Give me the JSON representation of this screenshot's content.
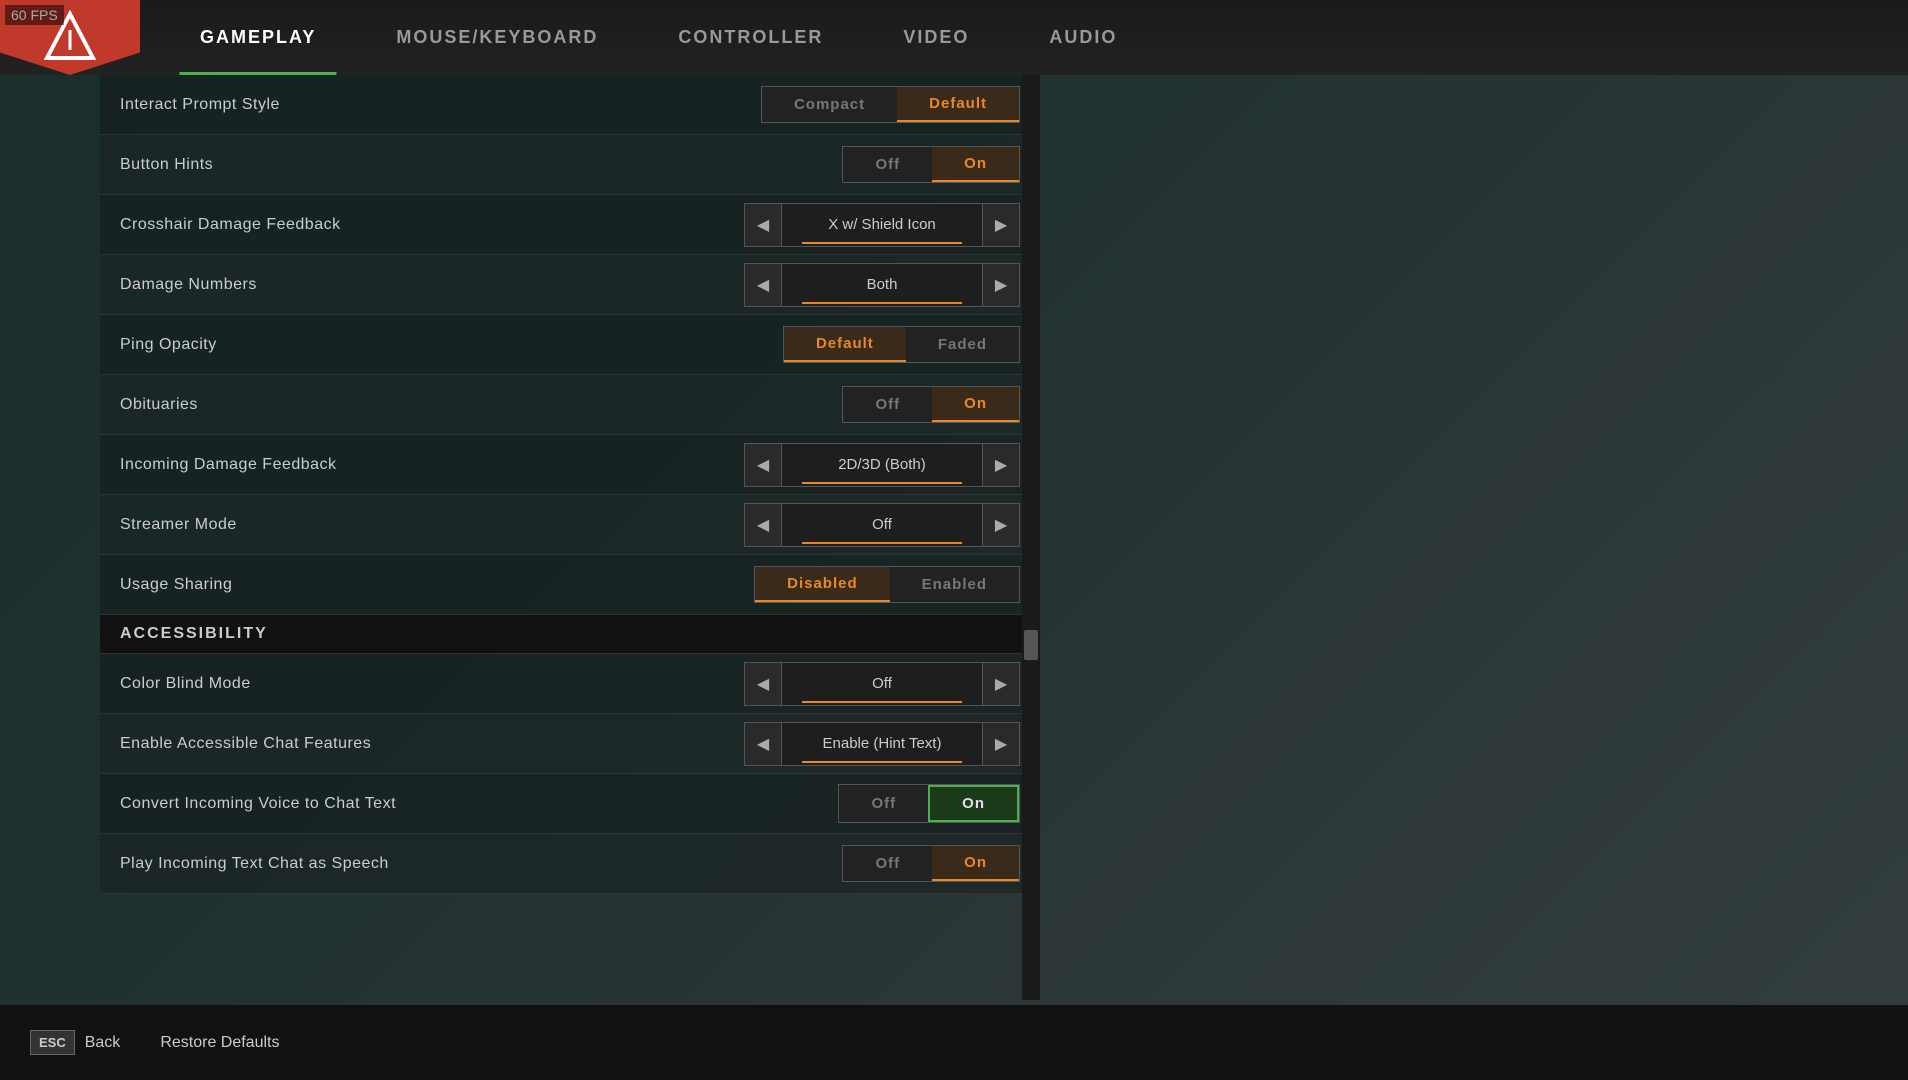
{
  "fps": "60 FPS",
  "nav": {
    "tabs": [
      {
        "id": "gameplay",
        "label": "GAMEPLAY",
        "active": true
      },
      {
        "id": "mouse_keyboard",
        "label": "MOUSE/KEYBOARD",
        "active": false
      },
      {
        "id": "controller",
        "label": "CONTROLLER",
        "active": false
      },
      {
        "id": "video",
        "label": "VIDEO",
        "active": false
      },
      {
        "id": "audio",
        "label": "AUDIO",
        "active": false
      }
    ]
  },
  "settings": [
    {
      "id": "interact_prompt_style",
      "label": "Interact Prompt Style",
      "type": "dual_button",
      "options": [
        "Compact",
        "Default"
      ],
      "selected": "Default"
    },
    {
      "id": "button_hints",
      "label": "Button Hints",
      "type": "dual_button",
      "options": [
        "Off",
        "On"
      ],
      "selected": "On"
    },
    {
      "id": "crosshair_damage_feedback",
      "label": "Crosshair Damage Feedback",
      "type": "arrow_selector",
      "value": "X w/ Shield Icon"
    },
    {
      "id": "damage_numbers",
      "label": "Damage Numbers",
      "type": "arrow_selector",
      "value": "Both"
    },
    {
      "id": "ping_opacity",
      "label": "Ping Opacity",
      "type": "dual_button",
      "options": [
        "Default",
        "Faded"
      ],
      "selected": "Default"
    },
    {
      "id": "obituaries",
      "label": "Obituaries",
      "type": "dual_button",
      "options": [
        "Off",
        "On"
      ],
      "selected": "On"
    },
    {
      "id": "incoming_damage_feedback",
      "label": "Incoming Damage Feedback",
      "type": "arrow_selector",
      "value": "2D/3D (Both)"
    },
    {
      "id": "streamer_mode",
      "label": "Streamer Mode",
      "type": "arrow_selector",
      "value": "Off"
    },
    {
      "id": "usage_sharing",
      "label": "Usage Sharing",
      "type": "dual_button",
      "options": [
        "Disabled",
        "Enabled"
      ],
      "selected": "Disabled"
    }
  ],
  "accessibility_section": "ACCESSIBILITY",
  "accessibility_settings": [
    {
      "id": "color_blind_mode",
      "label": "Color Blind Mode",
      "type": "arrow_selector",
      "value": "Off",
      "accent": "red"
    },
    {
      "id": "accessible_chat",
      "label": "Enable Accessible Chat Features",
      "type": "arrow_selector",
      "value": "Enable (Hint Text)"
    },
    {
      "id": "voice_to_chat",
      "label": "Convert Incoming Voice to Chat Text",
      "type": "dual_button",
      "options": [
        "Off",
        "On"
      ],
      "selected": "On",
      "highlight_selected": true
    },
    {
      "id": "text_as_speech",
      "label": "Play Incoming Text Chat as Speech",
      "type": "dual_button",
      "options": [
        "Off",
        "On"
      ],
      "selected": "On"
    }
  ],
  "bottom": {
    "esc_label": "ESC",
    "back_label": "Back",
    "restore_label": "Restore Defaults"
  },
  "icons": {
    "left_arrow": "◀",
    "right_arrow": "▶",
    "logo": "△"
  }
}
